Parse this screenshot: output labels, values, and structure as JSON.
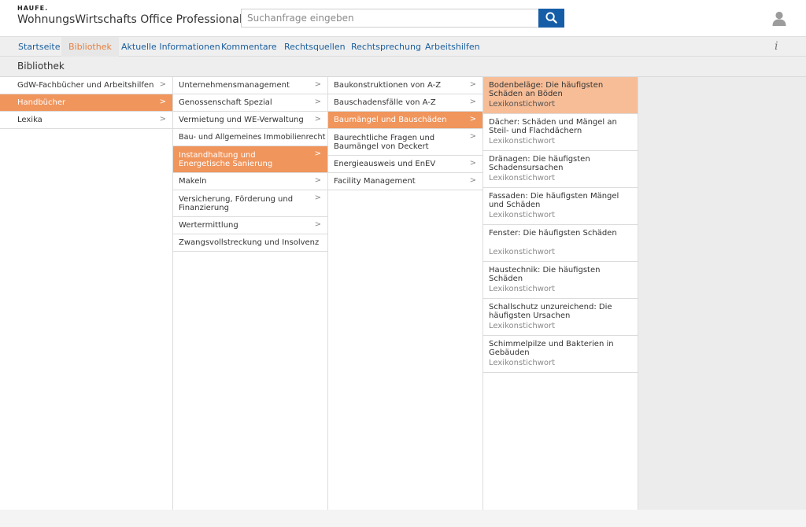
{
  "header": {
    "brand": "HAUFE.",
    "app_title": "WohnungsWirtschafts Office Professional",
    "search_placeholder": "Suchanfrage eingeben",
    "search_icon": "search-icon",
    "user_icon": "user-icon"
  },
  "nav": {
    "tabs": [
      {
        "label": "Startseite",
        "active": false
      },
      {
        "label": "Bibliothek",
        "active": true
      },
      {
        "label": "Aktuelle Informationen",
        "active": false
      },
      {
        "label": "Kommentare",
        "active": false
      },
      {
        "label": "Rechtsquellen",
        "active": false
      },
      {
        "label": "Rechtsprechung",
        "active": false
      },
      {
        "label": "Arbeitshilfen",
        "active": false
      }
    ],
    "info_label": "i"
  },
  "section": {
    "title": "Bibliothek"
  },
  "columns": {
    "col1": [
      {
        "label": "GdW-Fachbücher und Arbeitshilfen",
        "active": false
      },
      {
        "label": "Handbücher",
        "active": true
      },
      {
        "label": "Lexika",
        "active": false
      }
    ],
    "col2": [
      {
        "label": "Unternehmensmanagement",
        "active": false
      },
      {
        "label": "Genossenschaft Spezial",
        "active": false
      },
      {
        "label": "Vermietung und WE-Verwaltung",
        "active": false
      },
      {
        "label": "Bau- und Allgemeines Immobilienrecht",
        "active": false
      },
      {
        "label": "Instandhaltung und Energetische Sanierung",
        "active": true
      },
      {
        "label": "Makeln",
        "active": false
      },
      {
        "label": "Versicherung, Förderung und Finanzierung",
        "active": false
      },
      {
        "label": "Wertermittlung",
        "active": false
      },
      {
        "label": "Zwangsvollstreckung und Insolvenz",
        "active": false
      }
    ],
    "col3": [
      {
        "label": "Baukonstruktionen von A-Z",
        "active": false
      },
      {
        "label": "Bauschadensfälle von A-Z",
        "active": false
      },
      {
        "label": "Baumängel und Bauschäden",
        "active": true
      },
      {
        "label": "Baurechtliche Fragen und Baumängel von Deckert",
        "active": false
      },
      {
        "label": "Energieausweis und EnEV",
        "active": false
      },
      {
        "label": "Facility Management",
        "active": false
      }
    ],
    "col4": [
      {
        "title": "Bodenbeläge: Die häufigsten Schäden an Böden",
        "subtitle": "Lexikonstichwort",
        "active": true
      },
      {
        "title": "Dächer: Schäden und Mängel an Steil- und Flachdächern",
        "subtitle": "Lexikonstichwort",
        "active": false
      },
      {
        "title": "Dränagen: Die häufigsten Schadensursachen",
        "subtitle": "Lexikonstichwort",
        "active": false
      },
      {
        "title": "Fassaden: Die häufigsten Mängel und Schäden",
        "subtitle": "Lexikonstichwort",
        "active": false
      },
      {
        "title": "Fenster: Die häufigsten Schäden",
        "subtitle": "Lexikonstichwort",
        "active": false
      },
      {
        "title": "Haustechnik: Die häufigsten Schäden",
        "subtitle": "Lexikonstichwort",
        "active": false
      },
      {
        "title": "Schallschutz unzureichend: Die häufigsten Ursachen",
        "subtitle": "Lexikonstichwort",
        "active": false
      },
      {
        "title": "Schimmelpilze und Bakterien in Gebäuden",
        "subtitle": "Lexikonstichwort",
        "active": false
      }
    ]
  },
  "colors": {
    "accent_orange": "#f0955c",
    "selected_result": "#f6bd97",
    "nav_link": "#1a5e9e",
    "nav_active": "#e77e3c",
    "search_button": "#165da8"
  }
}
